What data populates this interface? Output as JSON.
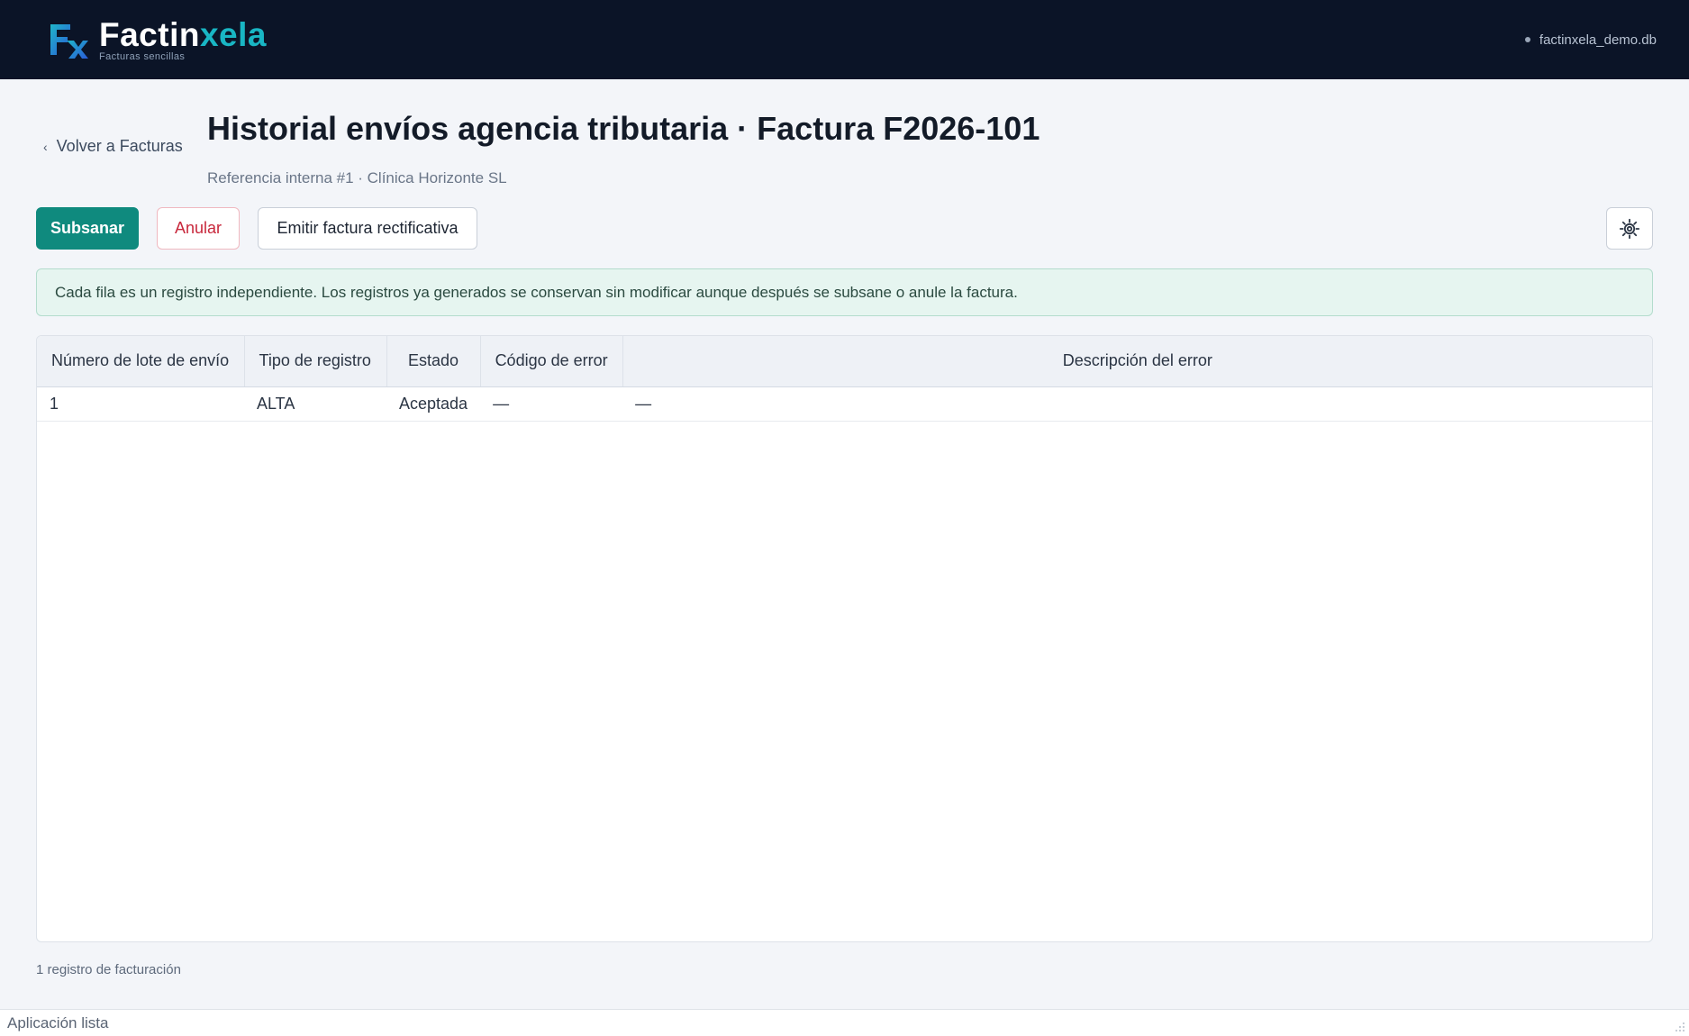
{
  "app": {
    "brand_name_part1": "Factin",
    "brand_name_part2": "xela",
    "brand_tagline": "Facturas sencillas",
    "database": "factinxela_demo.db"
  },
  "page": {
    "back_label": "Volver a Facturas",
    "title": "Historial envíos agencia tributaria · Factura F2026-101",
    "subtitle": "Referencia interna #1 · Clínica Horizonte SL"
  },
  "toolbar": {
    "subsanar_label": "Subsanar",
    "anular_label": "Anular",
    "rectificativa_label": "Emitir factura rectificativa",
    "settings_icon": "gear-icon"
  },
  "info_banner": "Cada fila es un registro independiente. Los registros ya generados se conservan sin modificar aunque después se subsane o anule la factura.",
  "table": {
    "headers": {
      "lote": "Número de lote de envío",
      "tipo": "Tipo de registro",
      "estado": "Estado",
      "codigo": "Código de error",
      "descripcion": "Descripción del error"
    },
    "rows": [
      {
        "lote": "1",
        "tipo": "ALTA",
        "estado": "Aceptada",
        "codigo": "—",
        "descripcion": "—"
      }
    ]
  },
  "footer_count": "1 registro de facturación",
  "status_bar": "Aplicación lista",
  "colors": {
    "header_bg": "#0b1427",
    "accent_teal": "#0f8a7e",
    "brand_cyan": "#19b6c4",
    "danger": "#c8283c"
  }
}
